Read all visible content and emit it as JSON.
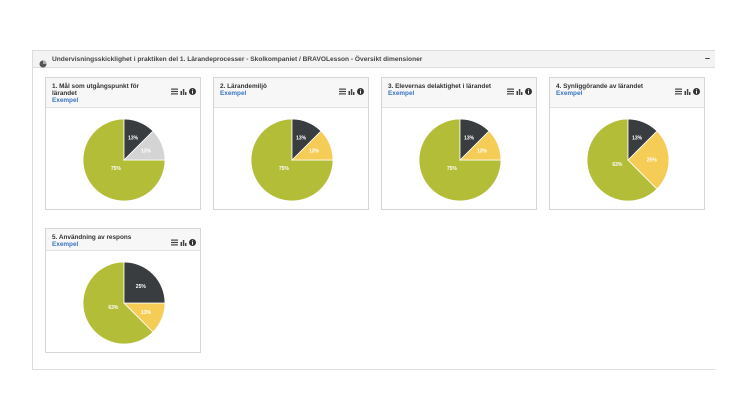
{
  "panel": {
    "title": "Undervisningsskicklighet i praktiken del 1. Lärandeprocesser - Skolkompaniet / BRAVOLesson - Översikt dimensioner",
    "collapse_label": "–"
  },
  "colors": {
    "green": "#b3bd37",
    "dark": "#3a3d40",
    "yellow": "#f5cd56",
    "gray": "#d4d4d4",
    "link": "#3a74c4"
  },
  "icons": [
    "list-icon",
    "bar-chart-icon",
    "info-icon"
  ],
  "cards": [
    {
      "title": "1. Mål som utgångspunkt för lärandet",
      "link": "Exempel",
      "chart_data": {
        "type": "pie",
        "slices": [
          {
            "label": "75%",
            "value": 75,
            "color": "#b3bd37"
          },
          {
            "label": "13%",
            "value": 12.5,
            "color": "#d4d4d4"
          },
          {
            "label": "13%",
            "value": 12.5,
            "color": "#3a3d40"
          }
        ]
      }
    },
    {
      "title": "2. Lärandemiljö",
      "link": "Exempel",
      "chart_data": {
        "type": "pie",
        "slices": [
          {
            "label": "75%",
            "value": 75,
            "color": "#b3bd37"
          },
          {
            "label": "13%",
            "value": 12.5,
            "color": "#f5cd56"
          },
          {
            "label": "13%",
            "value": 12.5,
            "color": "#3a3d40"
          }
        ]
      }
    },
    {
      "title": "3. Elevernas delaktighet i lärandet",
      "link": "Exempel",
      "chart_data": {
        "type": "pie",
        "slices": [
          {
            "label": "75%",
            "value": 75,
            "color": "#b3bd37"
          },
          {
            "label": "13%",
            "value": 12.5,
            "color": "#f5cd56"
          },
          {
            "label": "13%",
            "value": 12.5,
            "color": "#3a3d40"
          }
        ]
      }
    },
    {
      "title": "4. Synliggörande av lärandet",
      "link": "Exempel",
      "chart_data": {
        "type": "pie",
        "slices": [
          {
            "label": "63%",
            "value": 62.5,
            "color": "#b3bd37"
          },
          {
            "label": "25%",
            "value": 25,
            "color": "#f5cd56"
          },
          {
            "label": "13%",
            "value": 12.5,
            "color": "#3a3d40"
          }
        ]
      }
    },
    {
      "title": "5. Användning av respons",
      "link": "Exempel",
      "chart_data": {
        "type": "pie",
        "slices": [
          {
            "label": "63%",
            "value": 62.5,
            "color": "#b3bd37"
          },
          {
            "label": "13%",
            "value": 12.5,
            "color": "#f5cd56"
          },
          {
            "label": "25%",
            "value": 25,
            "color": "#3a3d40"
          }
        ]
      }
    }
  ]
}
